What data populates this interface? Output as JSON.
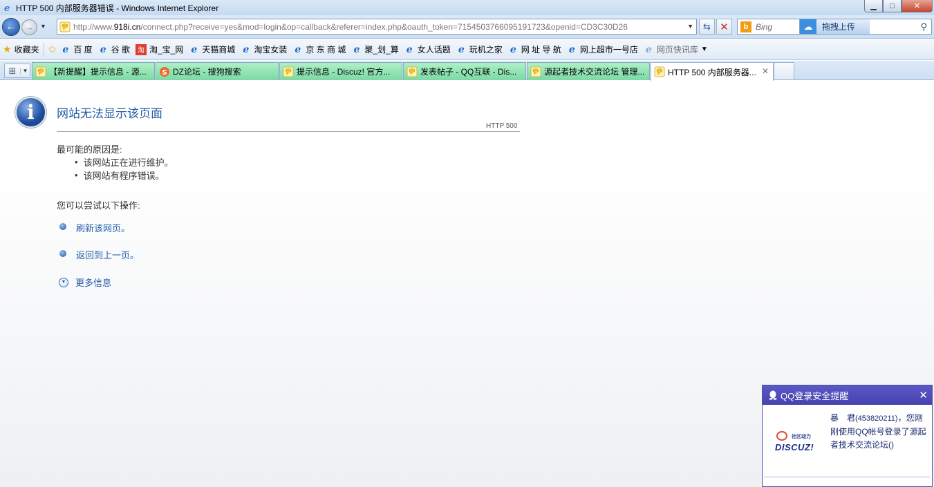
{
  "window": {
    "title": "HTTP 500 内部服务器错误 - Windows Internet Explorer",
    "controls": {
      "minimize": "▁",
      "maximize": "□",
      "close": "✕"
    }
  },
  "navbar": {
    "address_prefix": "http://www.",
    "address_domain": "918i.cn",
    "address_rest": "/connect.php?receive=yes&mod=login&op=callback&referer=index.php&oauth_token=7154503766095191723&openid=CD3C30D26",
    "search_placeholder": "Bing",
    "upload_label": "拖拽上传"
  },
  "favorites": {
    "label": "收藏夹",
    "items": [
      "百 度",
      "谷 歌",
      "淘_宝_网",
      "天猫商城",
      "淘宝女装",
      "京 东 商 城",
      "聚_划_算",
      "女人话题",
      "玩机之家",
      "网 址 导 航",
      "网上超市一号店",
      "网页快讯库"
    ]
  },
  "tabs": [
    {
      "label": "【新提醒】提示信息 - 源...",
      "icon": "discuz-icon"
    },
    {
      "label": "DZ论坛 - 搜狗搜索",
      "icon": "sogou-icon"
    },
    {
      "label": "提示信息 - Discuz! 官方...",
      "icon": "discuz-icon"
    },
    {
      "label": "发表帖子 - QQ互联 - Dis...",
      "icon": "discuz-icon"
    },
    {
      "label": "源起者技术交流论坛 管理...",
      "icon": "discuz-icon"
    },
    {
      "label": "HTTP 500 内部服务器...",
      "icon": "discuz-icon",
      "active": true
    }
  ],
  "error_page": {
    "title": "网站无法显示该页面",
    "code": "HTTP 500",
    "reasons_heading": "最可能的原因是:",
    "reasons": [
      "该网站正在进行维护。",
      "该网站有程序错误。"
    ],
    "actions_heading": "您可以尝试以下操作:",
    "actions": [
      "刷新该网页。",
      "返回到上一页。"
    ],
    "more_info": "更多信息"
  },
  "qq_popup": {
    "title": "QQ登录安全提醒",
    "logo_tag": "社区动力",
    "logo_brand": "DISCUZ!",
    "message_name": "暴　君",
    "message_uid": "(453820211)",
    "message_body": "，您刚刚使用QQ帐号登录了源起者技术交流论坛()"
  }
}
